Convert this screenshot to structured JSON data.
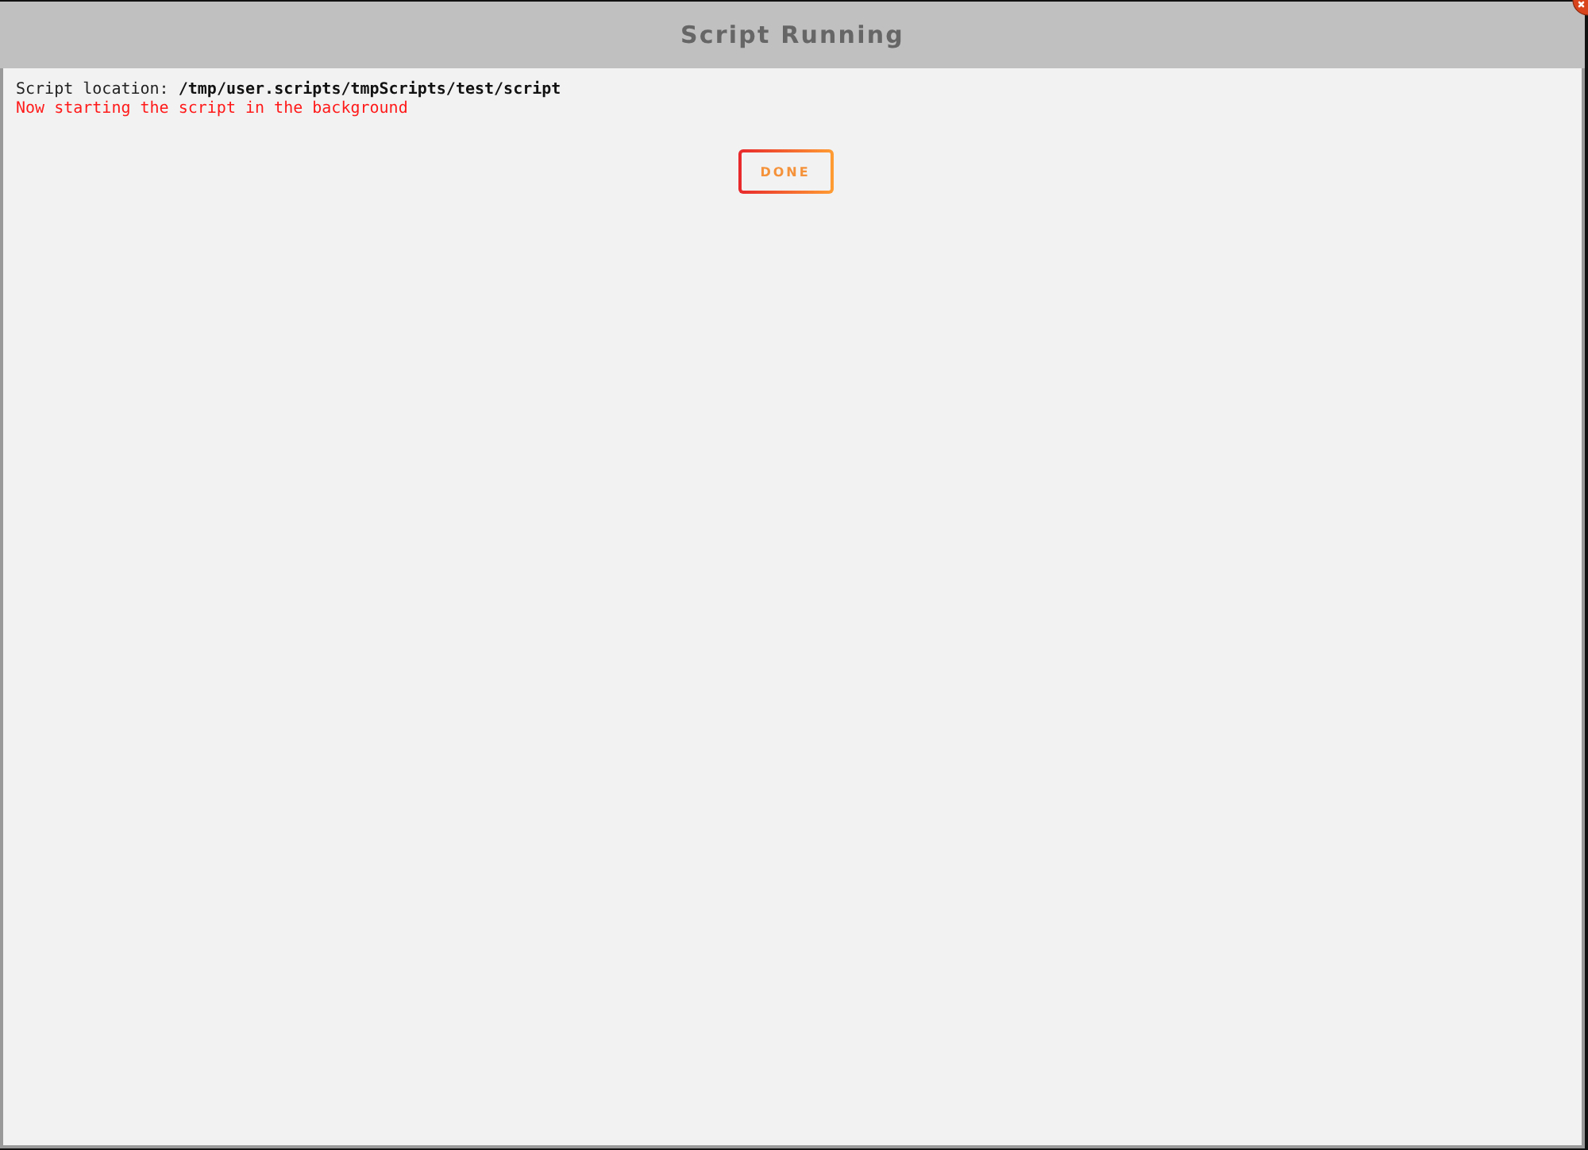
{
  "dialog": {
    "title": "Script Running",
    "lines": [
      {
        "kind": "info",
        "text": "Script location: **/tmp/user.scripts/tmpScripts/test/script**"
      },
      {
        "kind": "status",
        "text": "Now starting the script in the background"
      }
    ],
    "buttons": [
      "DONE"
    ]
  }
}
